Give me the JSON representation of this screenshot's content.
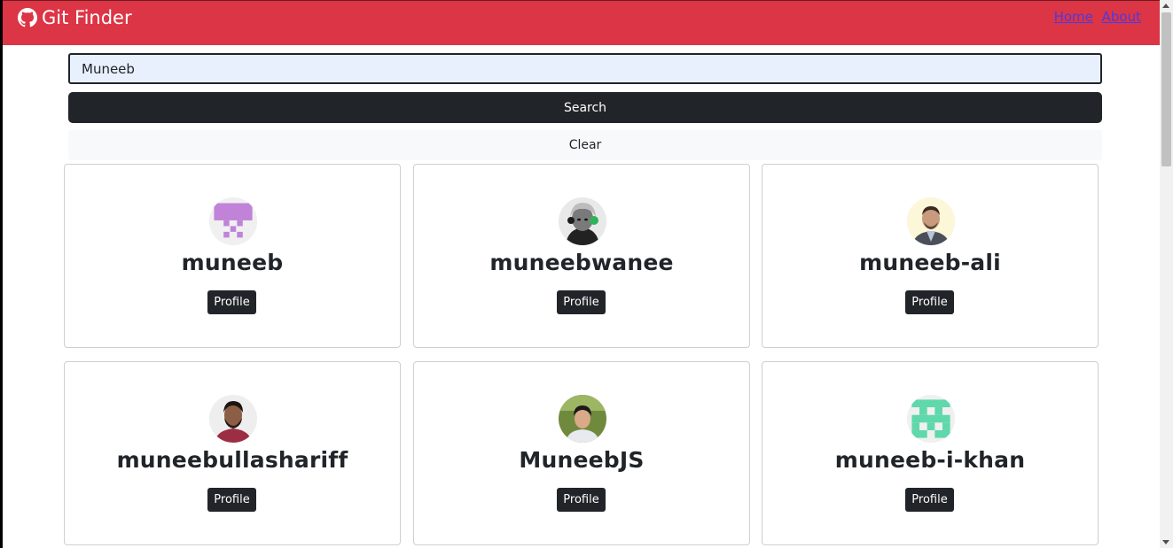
{
  "navbar": {
    "brand": "Git Finder",
    "links": [
      "Home",
      "About"
    ],
    "color": "#dc3545"
  },
  "search": {
    "value": "Muneeb",
    "search_label": "Search",
    "clear_label": "Clear"
  },
  "users": [
    {
      "login": "muneeb",
      "button": "Profile",
      "avatar": "identicon-purple"
    },
    {
      "login": "muneebwanee",
      "button": "Profile",
      "avatar": "photo-headphones"
    },
    {
      "login": "muneeb-ali",
      "button": "Profile",
      "avatar": "photo-man-suit"
    },
    {
      "login": "muneebullashariff",
      "button": "Profile",
      "avatar": "photo-man-beard"
    },
    {
      "login": "MuneebJS",
      "button": "Profile",
      "avatar": "photo-man-outdoor"
    },
    {
      "login": "muneeb-i-khan",
      "button": "Profile",
      "avatar": "identicon-green"
    }
  ]
}
